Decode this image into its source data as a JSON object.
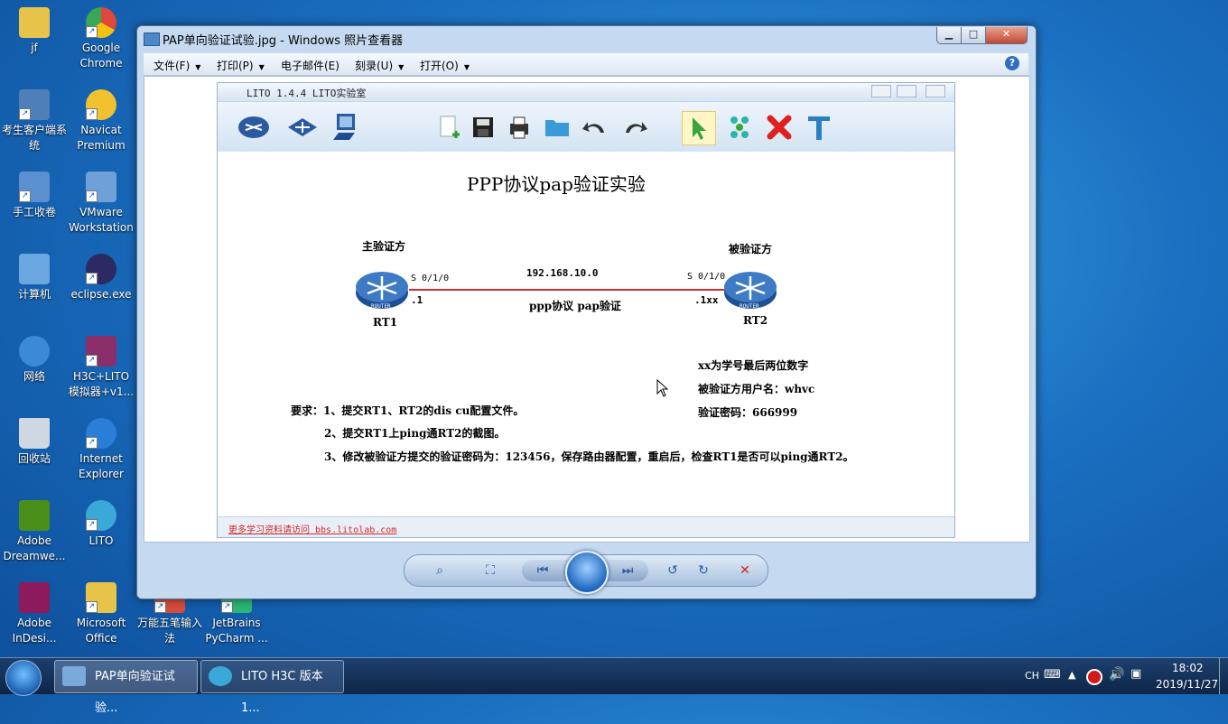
{
  "desktop": {
    "icons": [
      {
        "label": "jf",
        "color": "#e8c34a"
      },
      {
        "label": "Google Chrome",
        "color": "#e0473a"
      },
      {
        "label": "考生客户端系统",
        "color": "#4f7fb8"
      },
      {
        "label": "Navicat Premium",
        "color": "#f2c12e"
      },
      {
        "label": "手工收卷",
        "color": "#5a8fd0"
      },
      {
        "label": "VMware Workstation",
        "color": "#6fa0d8"
      },
      {
        "label": "计算机",
        "color": "#6aa6e0"
      },
      {
        "label": "eclipse.exe",
        "color": "#2c2a64"
      },
      {
        "label": "网络",
        "color": "#3b8ad8"
      },
      {
        "label": "H3C+LITO 模拟器+v1...",
        "color": "#8b2f6a"
      },
      {
        "label": "回收站",
        "color": "#cfd8e2"
      },
      {
        "label": "Internet Explorer",
        "color": "#2a7ed8"
      },
      {
        "label": "Adobe Dreamwe...",
        "color": "#4a8f1a"
      },
      {
        "label": "LITO",
        "color": "#3aa9d8"
      },
      {
        "label": "Adobe InDesi...",
        "color": "#8d1a5c"
      },
      {
        "label": "Microsoft Office",
        "color": "#e8c34a"
      },
      {
        "label": "万能五笔输入法",
        "color": "#d84a3a"
      },
      {
        "label": "JetBrains PyCharm ...",
        "color": "#2bb673"
      }
    ]
  },
  "window": {
    "title": "PAP单向验证试验.jpg - Windows 照片查看器",
    "buttons": {
      "minimize": "▁",
      "maximize": "□",
      "close": "✕"
    },
    "menu": [
      "文件(F)",
      "打印(P)",
      "电子邮件(E)",
      "刻录(U)",
      "打开(O)"
    ],
    "help": "?"
  },
  "photo": {
    "inner_title": "LITO 1.4.4  LITO实验室",
    "diagram_title": "PPP协议pap验证实验",
    "left_role": "主验证方",
    "right_role": "被验证方",
    "left_port": "S 0/1/0",
    "right_port": "S 0/1/0",
    "network": "192.168.10.0",
    "link_label": "ppp协议 pap验证",
    "left_ip": ".1",
    "right_ip": ".1xx",
    "left_name": "RT1",
    "right_name": "RT2",
    "router_tag": "ROUTER",
    "note1": "xx为学号最后两位数字",
    "note2": "被验证方用户名：whvc",
    "note3": "验证密码：666999",
    "req1": "要求：1、提交RT1、RT2的dis cu配置文件。",
    "req2": "2、提交RT1上ping通RT2的截图。",
    "req3": "3、修改被验证方提交的验证密码为：123456，保存路由器配置，重启后，检查RT1是否可以ping通RT2。",
    "footer_link": "更多学习资料请访问 bbs.litolab.com",
    "link_color": "#d42a2a"
  },
  "taskbar": {
    "items": [
      "PAP单向验证试验...",
      "LITO H3C 版本 1..."
    ],
    "lang": "CH",
    "time": "18:02",
    "date": "2019/11/27"
  }
}
